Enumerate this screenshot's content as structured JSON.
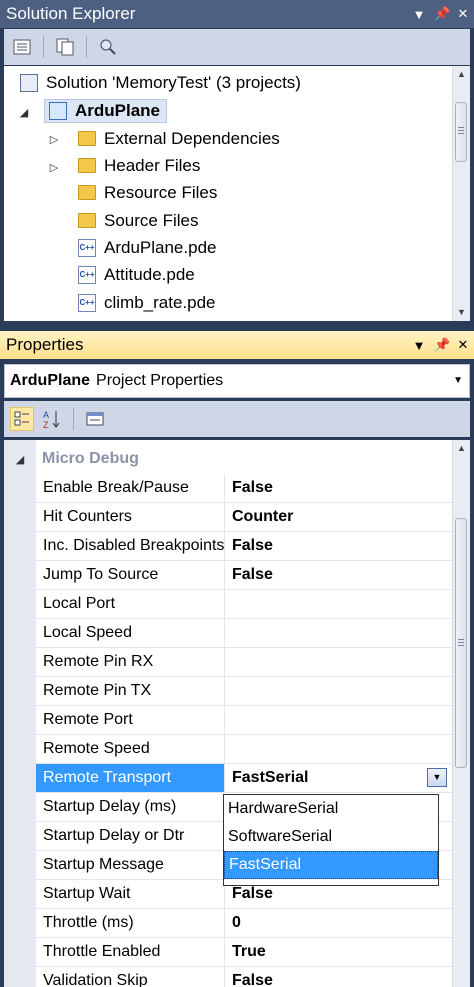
{
  "solution_explorer": {
    "title": "Solution Explorer",
    "solution_label": "Solution 'MemoryTest' (3 projects)",
    "project_label": "ArduPlane",
    "items": [
      {
        "label": "External Dependencies",
        "icon": "folder-link-icon"
      },
      {
        "label": "Header Files",
        "icon": "folder-icon"
      },
      {
        "label": "Resource Files",
        "icon": "folder-icon"
      },
      {
        "label": "Source Files",
        "icon": "folder-icon"
      },
      {
        "label": "ArduPlane.pde",
        "icon": "cpp-file-icon"
      },
      {
        "label": "Attitude.pde",
        "icon": "cpp-file-icon"
      },
      {
        "label": "climb_rate.pde",
        "icon": "cpp-file-icon"
      }
    ],
    "file_icon_text": "C++"
  },
  "properties": {
    "title": "Properties",
    "object_name": "ArduPlane",
    "object_type": "Project Properties",
    "category": "Micro Debug",
    "rows": [
      {
        "name": "Enable Break/Pause",
        "value": "False"
      },
      {
        "name": "Hit Counters",
        "value": "Counter"
      },
      {
        "name": "Inc. Disabled Breakpoints",
        "value": "False"
      },
      {
        "name": "Jump To Source",
        "value": "False"
      },
      {
        "name": "Local Port",
        "value": ""
      },
      {
        "name": "Local Speed",
        "value": ""
      },
      {
        "name": "Remote Pin RX",
        "value": ""
      },
      {
        "name": "Remote Pin TX",
        "value": ""
      },
      {
        "name": "Remote Port",
        "value": ""
      },
      {
        "name": "Remote Speed",
        "value": ""
      },
      {
        "name": "Remote Transport",
        "value": "FastSerial"
      },
      {
        "name": "Startup Delay (ms)",
        "value": ""
      },
      {
        "name": "Startup Delay or Dtr",
        "value": ""
      },
      {
        "name": "Startup Message",
        "value": ""
      },
      {
        "name": "Startup Wait",
        "value": "False"
      },
      {
        "name": "Throttle (ms)",
        "value": "0"
      },
      {
        "name": "Throttle Enabled",
        "value": "True"
      },
      {
        "name": "Validation Skip",
        "value": "False"
      }
    ],
    "dropdown_options": [
      "HardwareSerial",
      "SoftwareSerial",
      "FastSerial"
    ],
    "selected_option": "FastSerial"
  }
}
